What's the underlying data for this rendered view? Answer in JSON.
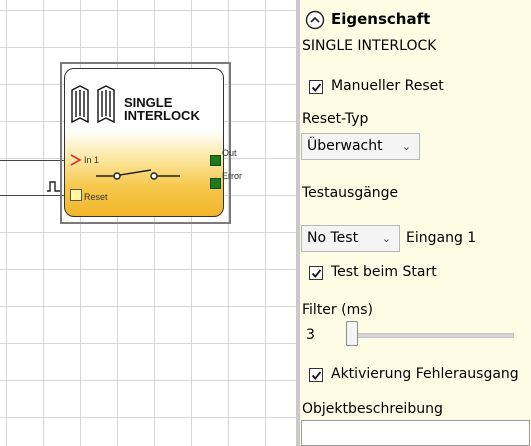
{
  "block": {
    "title_line1": "SINGLE",
    "title_line2": "INTERLOCK",
    "input1_label": "In 1",
    "reset_label": "Reset",
    "out_label": "Out",
    "error_label": "Error"
  },
  "panel": {
    "header": "Eigenschaft",
    "subtitle": "SINGLE INTERLOCK",
    "manual_reset": {
      "label": "Manueller Reset",
      "checked": true
    },
    "reset_type": {
      "label": "Reset-Typ",
      "value": "Überwacht"
    },
    "test_outputs": {
      "label": "Testausgänge",
      "value": "No Test",
      "input_label": "Eingang 1"
    },
    "test_at_start": {
      "label": "Test beim Start",
      "checked": true
    },
    "filter": {
      "label": "Filter (ms)",
      "value": "3"
    },
    "error_output": {
      "label": "Aktivierung Fehlerausgang",
      "checked": true
    },
    "object_description": {
      "label": "Objektbeschreibung",
      "value": ""
    }
  },
  "colors": {
    "block_fill_top": "#ffffff",
    "block_fill_bottom": "#f2b62c",
    "panel_bg": "#fdfde6",
    "pin_green": "#1f7a1f",
    "input_arrow": "#e0302a"
  },
  "icons": [
    "light-curtain-icon",
    "switch-symbol-icon",
    "reset-pulse-icon",
    "collapse-chevron-icon",
    "checkmark-icon"
  ]
}
